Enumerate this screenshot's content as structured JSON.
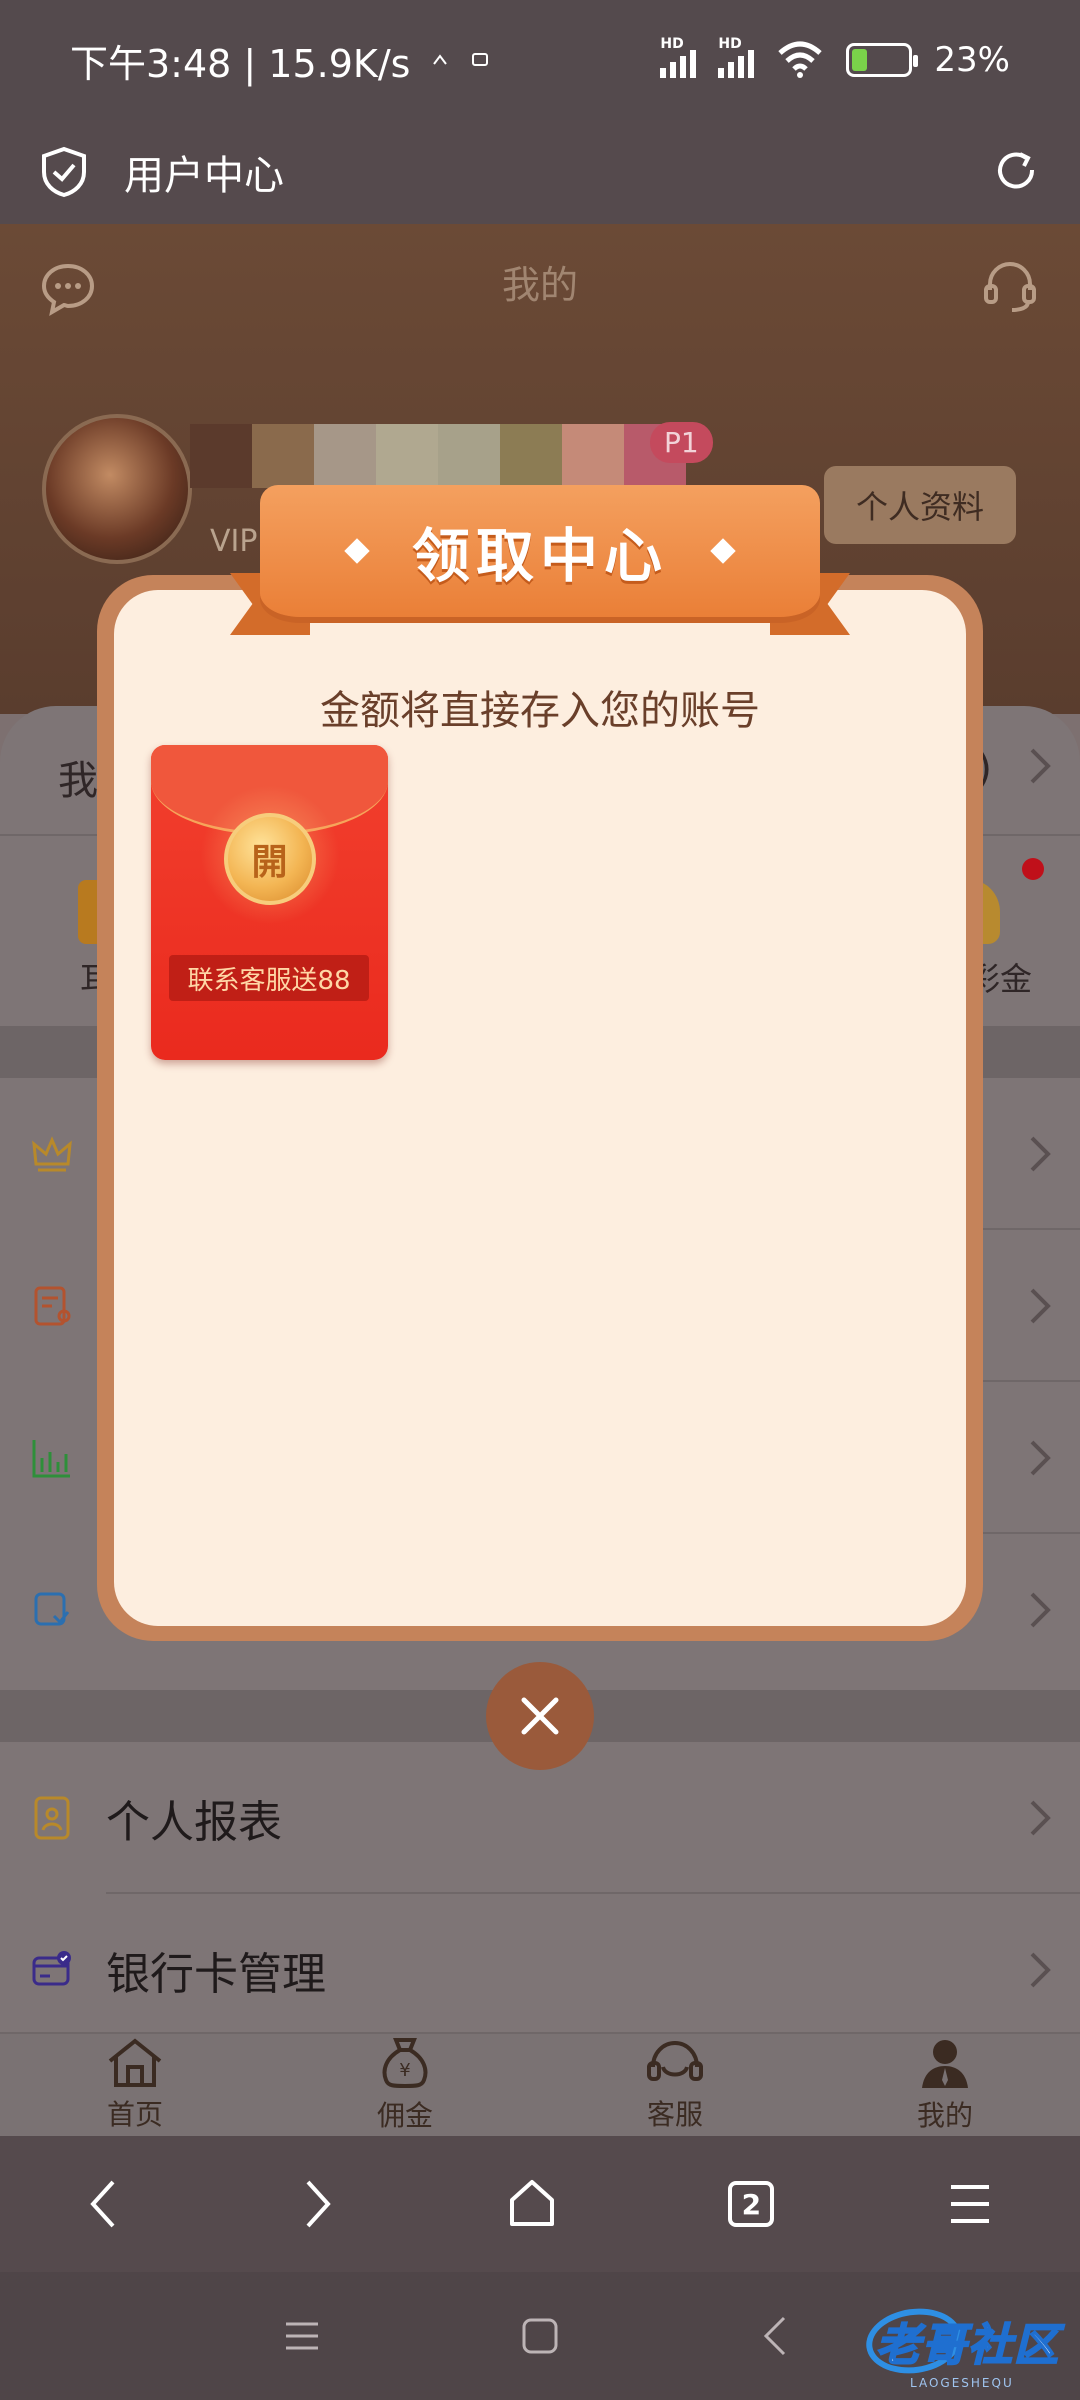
{
  "status_bar": {
    "time_speed": "下午3:48 | 15.9K/s",
    "network_1": "HD",
    "network_2": "HD",
    "battery": "23%"
  },
  "header": {
    "title": "用户中心"
  },
  "page": {
    "title": "我的",
    "vip_text": "VIP",
    "level_badge": "P1",
    "profile_button": "个人资料",
    "wallet_label": "我",
    "wallet_suffix": ")",
    "quick_left_label": "耳",
    "quick_right_label": "彩金",
    "menu": [
      {
        "label": "个人报表"
      },
      {
        "label": "银行卡管理"
      }
    ]
  },
  "modal": {
    "title": "领取中心",
    "subtitle": "金额将直接存入您的账号",
    "envelope_char": "開",
    "envelope_label": "联系客服送88"
  },
  "app_nav": [
    {
      "label": "首页",
      "icon": "home-icon"
    },
    {
      "label": "佣金",
      "icon": "money-bag-icon"
    },
    {
      "label": "客服",
      "icon": "headset-icon"
    },
    {
      "label": "我的",
      "icon": "user-icon"
    }
  ],
  "browser_nav": {
    "tab_count": "2"
  },
  "watermark": {
    "text": "老哥社区",
    "sub": "LAOGESHEQU"
  },
  "colors": {
    "ribbon": "#ea7f37",
    "modal_frame": "#c5835a",
    "modal_bg": "#fdeedf",
    "envelope": "#ea2a1e"
  }
}
